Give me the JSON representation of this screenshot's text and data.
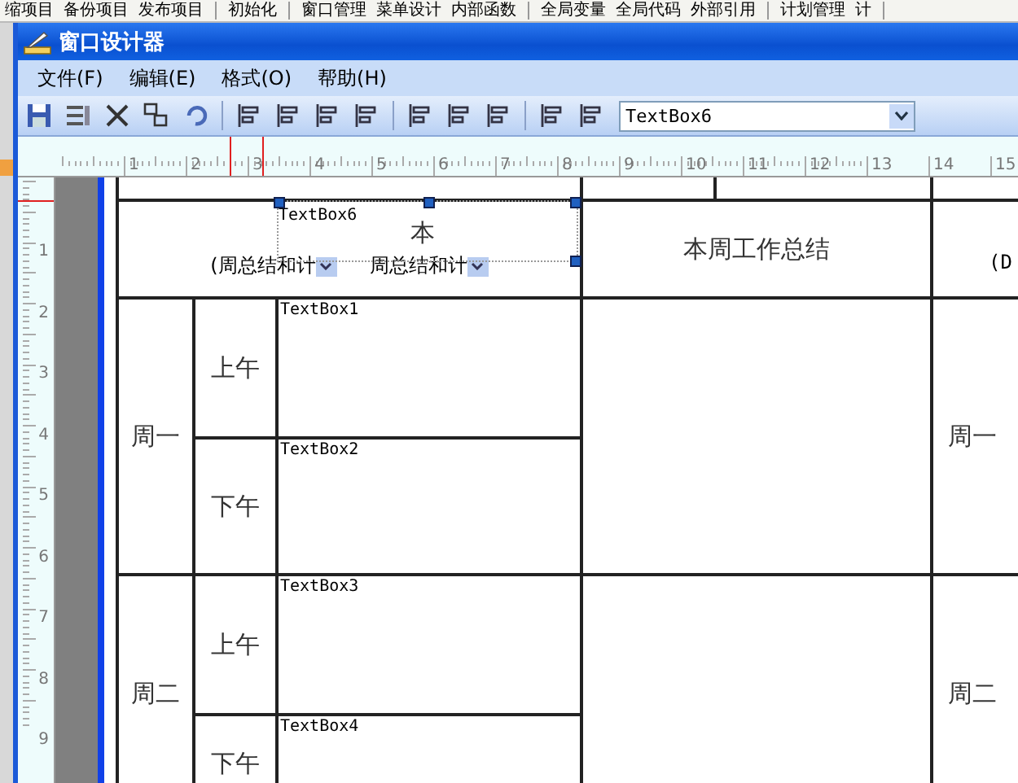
{
  "background_toolbar": {
    "groups": [
      [
        "缩项目",
        "备份项目",
        "发布项目"
      ],
      [
        "初始化"
      ],
      [
        "窗口管理",
        "菜单设计",
        "内部函数"
      ],
      [
        "全局变量",
        "全局代码",
        "外部引用"
      ],
      [
        "计划管理",
        "计"
      ]
    ]
  },
  "window": {
    "title": "窗口设计器"
  },
  "menu": [
    {
      "label": "文件(F)"
    },
    {
      "label": "编辑(E)"
    },
    {
      "label": "格式(O)"
    },
    {
      "label": "帮助(H)"
    }
  ],
  "toolbar": {
    "object_select": {
      "value": "TextBox6"
    }
  },
  "ruler": {
    "horizontal_labels": [
      "1",
      "2",
      "3",
      "4",
      "5",
      "6",
      "7",
      "8",
      "9",
      "10",
      "11",
      "12",
      "13",
      "14",
      "15"
    ],
    "vertical_labels": [
      "1",
      "2",
      "3",
      "4",
      "5",
      "6",
      "7",
      "8",
      "9"
    ]
  },
  "form": {
    "header": {
      "textbox": {
        "label": "TextBox6",
        "selected": true
      },
      "title": "本",
      "dropdowns": [
        "(周总结和计",
        "周总结和计"
      ],
      "summary": "本周工作总结",
      "column_5": "(D"
    },
    "days": [
      {
        "label": "周一",
        "right_label": "周一",
        "periods": [
          {
            "label": "上午",
            "textbox": {
              "label": "TextBox1",
              "selected": false
            }
          },
          {
            "label": "下午",
            "textbox": {
              "label": "TextBox2",
              "selected": false
            }
          }
        ]
      },
      {
        "label": "周二",
        "right_label": "周二",
        "periods": [
          {
            "label": "上午",
            "textbox": {
              "label": "TextBox3",
              "selected": false
            }
          },
          {
            "label": "下午",
            "textbox": {
              "label": "TextBox4",
              "selected": false
            }
          }
        ]
      }
    ]
  }
}
